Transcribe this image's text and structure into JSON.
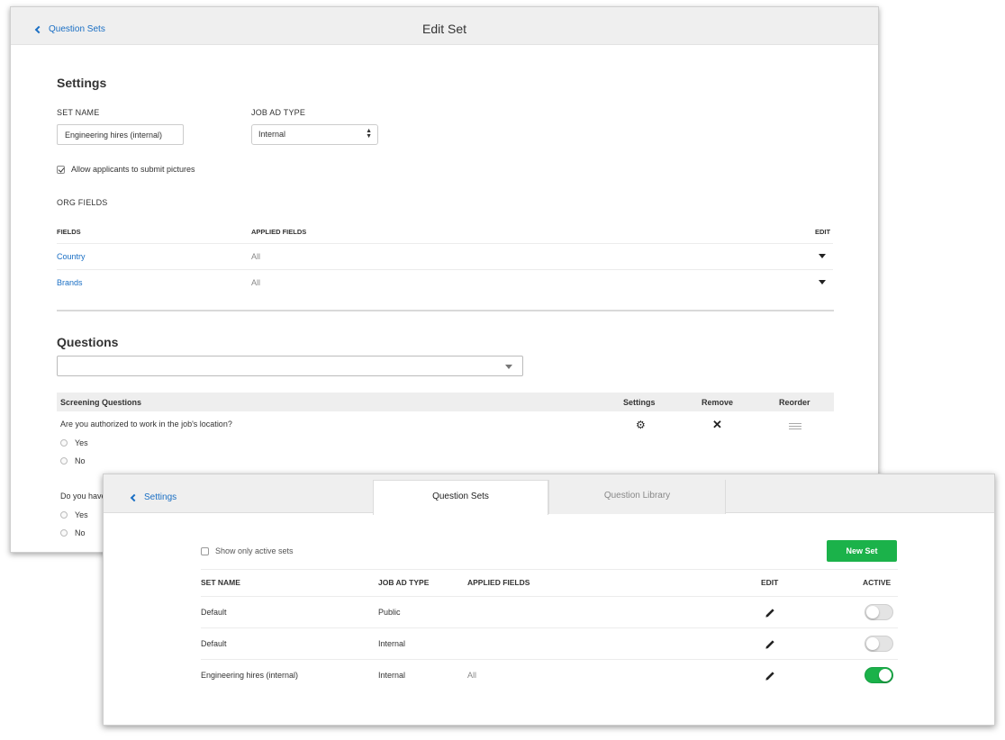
{
  "edit_set": {
    "back_label": "Question Sets",
    "title": "Edit Set",
    "settings_heading": "Settings",
    "set_name_label": "SET NAME",
    "set_name_value": "Engineering hires (internal)",
    "job_ad_type_label": "JOB AD TYPE",
    "job_ad_type_value": "Internal",
    "allow_pictures_label": "Allow applicants to submit pictures",
    "allow_pictures_checked": true,
    "org_fields_label": "ORG FIELDS",
    "org_table": {
      "headers": [
        "FIELDS",
        "APPLIED FIELDS",
        "EDIT"
      ],
      "rows": [
        {
          "field": "Country",
          "applied": "All"
        },
        {
          "field": "Brands",
          "applied": "All"
        }
      ]
    },
    "questions_heading": "Questions",
    "question_select_value": "",
    "questions_table": {
      "headers": [
        "Screening Questions",
        "Settings",
        "Remove",
        "Reorder"
      ],
      "rows": [
        {
          "text": "Are you authorized to work in the job's location?",
          "options": [
            "Yes",
            "No"
          ]
        },
        {
          "text": "Do you have",
          "options": [
            "Yes",
            "No"
          ]
        }
      ]
    }
  },
  "question_sets": {
    "back_label": "Settings",
    "tabs": [
      {
        "label": "Question Sets",
        "active": true
      },
      {
        "label": "Question Library",
        "active": false
      }
    ],
    "show_only_active_label": "Show only active sets",
    "show_only_active_checked": false,
    "new_set_label": "New Set",
    "headers": [
      "SET NAME",
      "JOB AD TYPE",
      "APPLIED FIELDS",
      "EDIT",
      "ACTIVE"
    ],
    "rows": [
      {
        "name": "Default",
        "type": "Public",
        "applied": "",
        "active": false
      },
      {
        "name": "Default",
        "type": "Internal",
        "applied": "",
        "active": false
      },
      {
        "name": "Engineering hires (internal)",
        "type": "Internal",
        "applied": "All",
        "active": true
      }
    ]
  },
  "colors": {
    "link": "#1a6fc4",
    "accent_green": "#1bb24a",
    "header_bg": "#efefef"
  },
  "icons": [
    "chevron-left-icon",
    "select-arrows-icon",
    "caret-down-icon",
    "gear-icon",
    "close-icon",
    "reorder-icon",
    "pencil-icon",
    "toggle-switch"
  ]
}
